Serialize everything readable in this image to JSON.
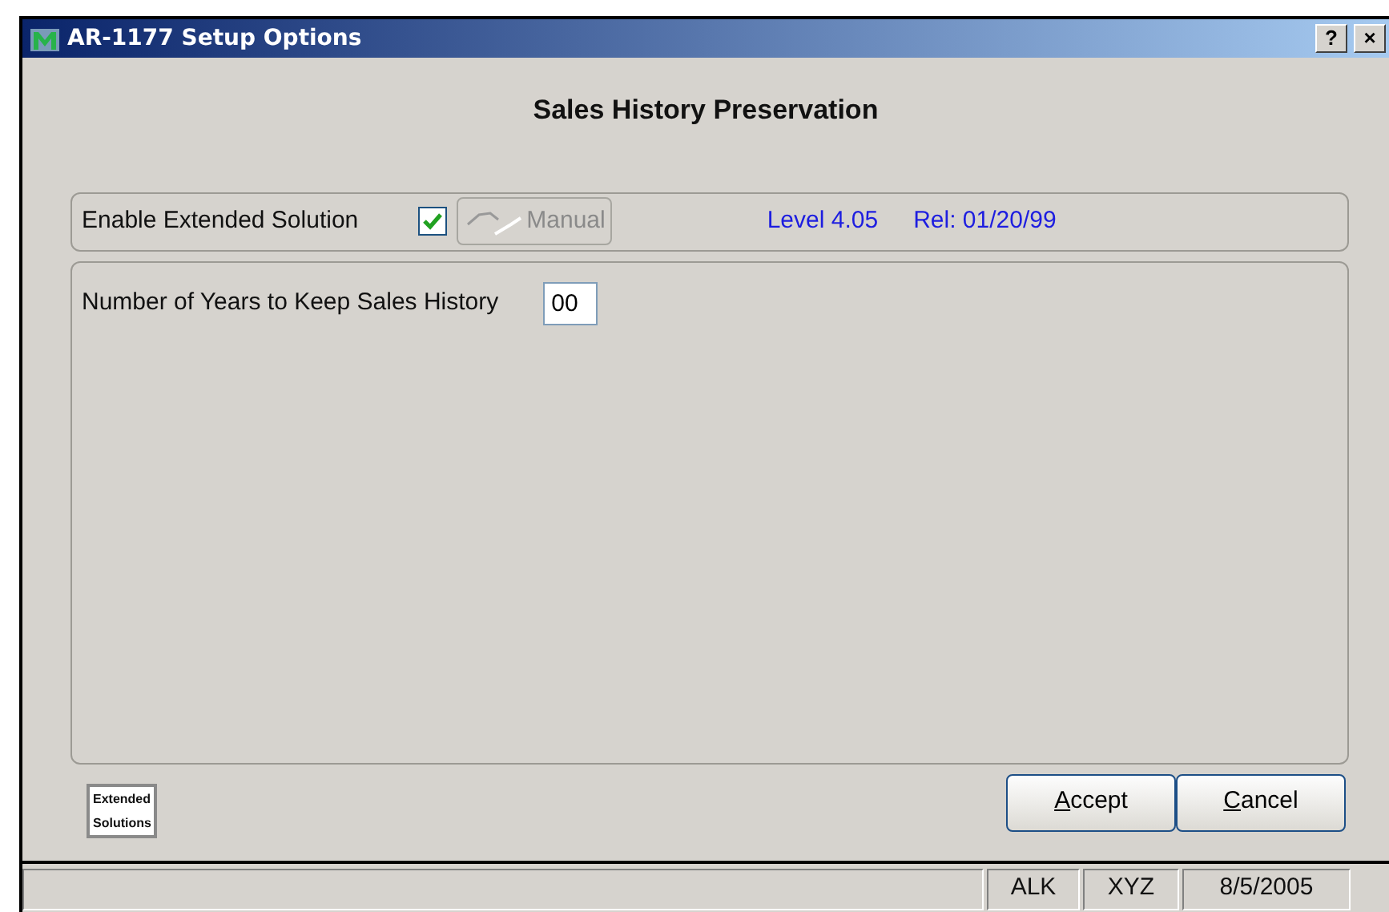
{
  "window": {
    "title": "AR-1177 Setup Options",
    "help_button": "?",
    "close_button": "×"
  },
  "heading": "Sales History Preservation",
  "options": {
    "enable_label": "Enable Extended Solution",
    "enable_checked": true,
    "manual_button": {
      "label": "Manual",
      "disabled": true
    },
    "level": "Level 4.05",
    "release": "Rel: 01/20/99"
  },
  "fields": [
    {
      "label": "Number of Years to Keep Sales History",
      "value": "00"
    }
  ],
  "logo": {
    "line_1": "Extended",
    "line_2": "Solutions"
  },
  "buttons": [
    {
      "label": "Accept"
    },
    {
      "label": "Cancel"
    }
  ],
  "status_bar": [
    "ALK",
    "XYZ",
    "8/5/2005"
  ]
}
